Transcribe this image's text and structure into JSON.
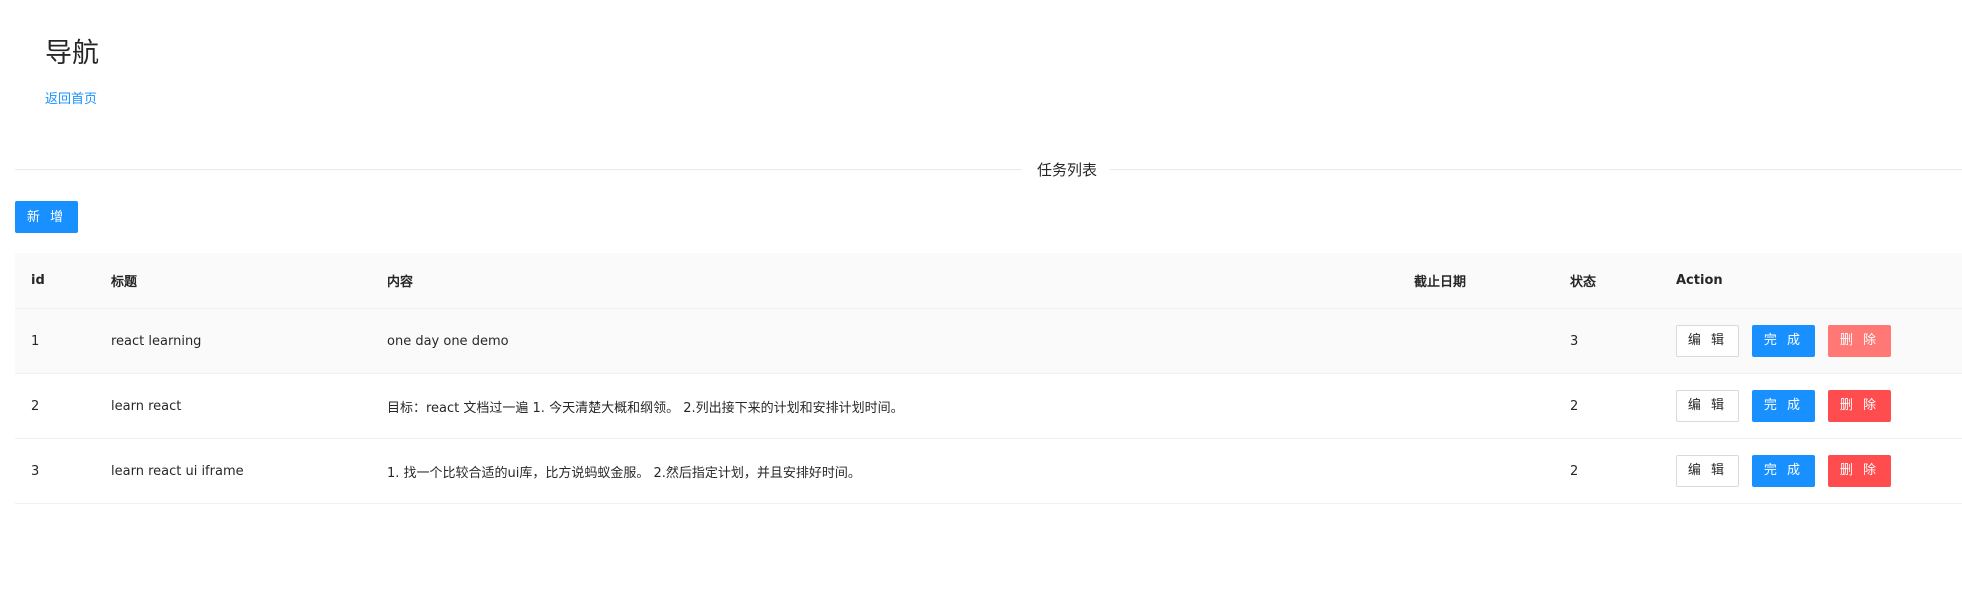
{
  "nav": {
    "title": "导航",
    "home_link": "返回首页"
  },
  "divider": {
    "label": "任务列表"
  },
  "toolbar": {
    "add_label": "新 增"
  },
  "table": {
    "headers": {
      "id": "id",
      "title": "标题",
      "content": "内容",
      "deadline": "截止日期",
      "status": "状态",
      "action": "Action"
    },
    "rows": [
      {
        "id": "1",
        "title": "react learning",
        "content": "one day one demo",
        "deadline": "",
        "status": "3",
        "edit": "编 辑",
        "done": "完 成",
        "delete": "删 除"
      },
      {
        "id": "2",
        "title": "learn react",
        "content": "目标：react 文档过一遍 1. 今天清楚大概和纲领。 2.列出接下来的计划和安排计划时间。",
        "deadline": "",
        "status": "2",
        "edit": "编 辑",
        "done": "完 成",
        "delete": "删 除"
      },
      {
        "id": "3",
        "title": "learn react ui iframe",
        "content": "1. 找一个比较合适的ui库，比方说蚂蚁金服。 2.然后指定计划，并且安排好时间。",
        "deadline": "",
        "status": "2",
        "edit": "编 辑",
        "done": "完 成",
        "delete": "删 除"
      }
    ]
  },
  "colors": {
    "primary": "#1890ff",
    "danger": "#ff4d4f",
    "danger_disabled": "#ff7875",
    "header_bg": "#fafafa"
  }
}
